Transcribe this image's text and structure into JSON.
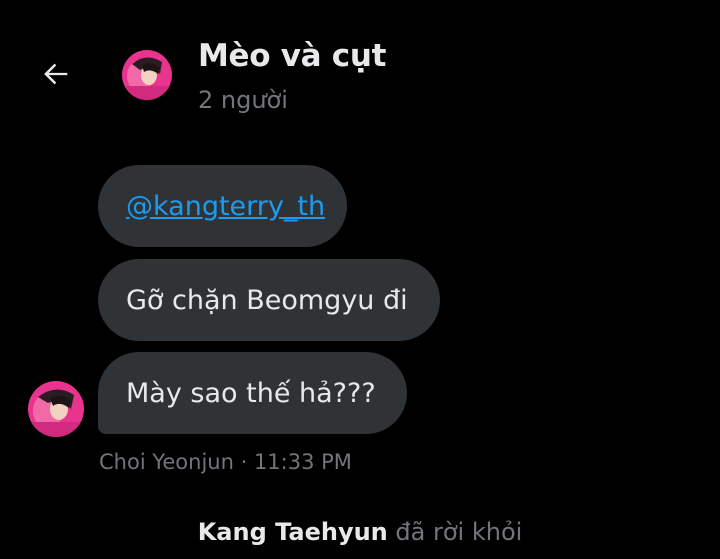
{
  "header": {
    "back_icon": "arrow-left-icon",
    "group_name": "Mèo và cụt",
    "member_count": "2 người",
    "avatar_icon": "group-avatar"
  },
  "messages": [
    {
      "text": "@kangterry_th",
      "is_mention": true
    },
    {
      "text": "Gỡ chặn Beomgyu đi"
    },
    {
      "text": "Mày sao thế hả???"
    }
  ],
  "message_meta": {
    "sender": "Choi Yeonjun",
    "separator": " · ",
    "time": "11:33 PM"
  },
  "system_event": {
    "name": "Kang Taehyun",
    "action": " đã rời khỏi"
  },
  "colors": {
    "background": "#000000",
    "bubble": "#2f3336",
    "text": "#e7e9ea",
    "muted": "#71767b",
    "link": "#1d9bf0",
    "avatar_pink": "#e8348f"
  }
}
